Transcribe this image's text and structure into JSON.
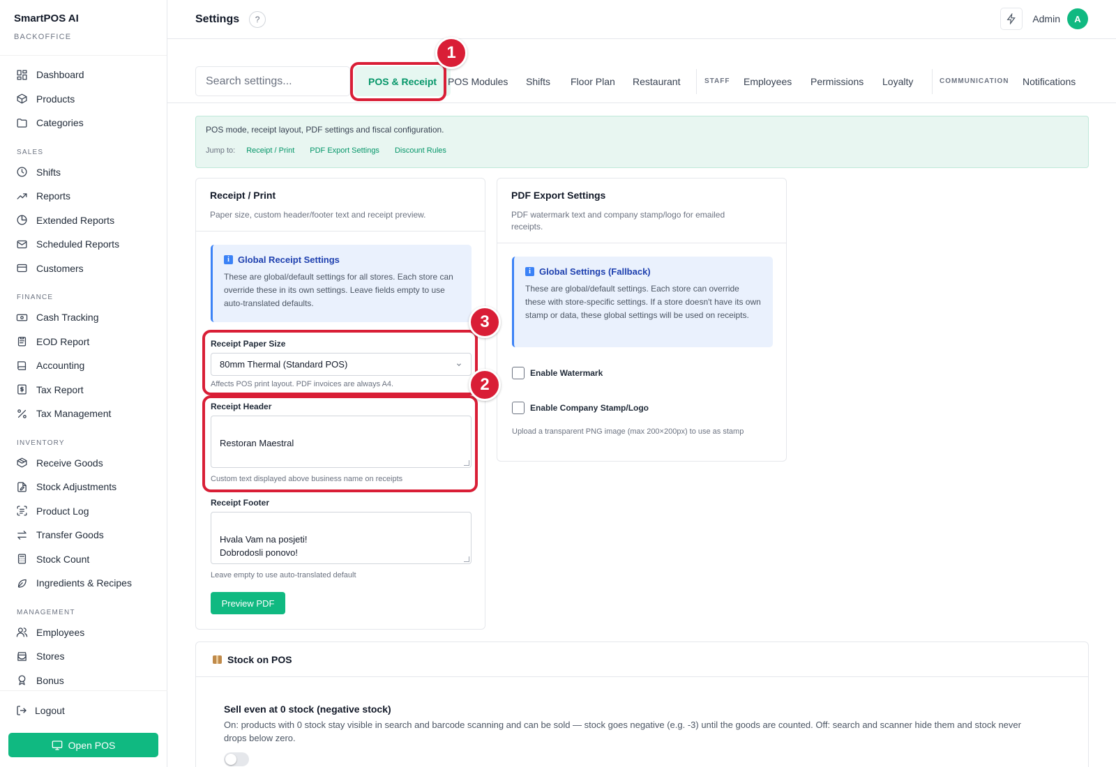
{
  "sidebar": {
    "brand_title": "SmartPOS AI",
    "brand_subtitle": "BACKOFFICE",
    "sections": [
      {
        "label": "",
        "items": [
          {
            "label": "Dashboard",
            "icon": "dashboard-icon"
          },
          {
            "label": "Products",
            "icon": "box-icon"
          },
          {
            "label": "Categories",
            "icon": "folder-icon"
          }
        ]
      },
      {
        "label": "SALES",
        "items": [
          {
            "label": "Shifts",
            "icon": "clock-icon"
          },
          {
            "label": "Reports",
            "icon": "trending-icon"
          },
          {
            "label": "Extended Reports",
            "icon": "pie-icon"
          },
          {
            "label": "Scheduled Reports",
            "icon": "mail-icon"
          },
          {
            "label": "Customers",
            "icon": "card-icon"
          }
        ]
      },
      {
        "label": "FINANCE",
        "items": [
          {
            "label": "Cash Tracking",
            "icon": "cash-icon"
          },
          {
            "label": "EOD Report",
            "icon": "clipboard-icon"
          },
          {
            "label": "Accounting",
            "icon": "book-icon"
          },
          {
            "label": "Tax Report",
            "icon": "dollar-icon"
          },
          {
            "label": "Tax Management",
            "icon": "percent-icon"
          }
        ]
      },
      {
        "label": "INVENTORY",
        "items": [
          {
            "label": "Receive Goods",
            "icon": "package-icon"
          },
          {
            "label": "Stock Adjustments",
            "icon": "file-edit-icon"
          },
          {
            "label": "Product Log",
            "icon": "scan-icon"
          },
          {
            "label": "Transfer Goods",
            "icon": "transfer-icon"
          },
          {
            "label": "Stock Count",
            "icon": "calculator-icon"
          },
          {
            "label": "Ingredients & Recipes",
            "icon": "leaf-icon"
          }
        ]
      },
      {
        "label": "MANAGEMENT",
        "items": [
          {
            "label": "Employees",
            "icon": "users-icon"
          },
          {
            "label": "Stores",
            "icon": "store-icon"
          },
          {
            "label": "Bonus",
            "icon": "award-icon"
          }
        ]
      }
    ],
    "logout_label": "Logout",
    "open_pos_label": "Open POS"
  },
  "header": {
    "title": "Settings",
    "help_glyph": "?",
    "user_name": "Admin",
    "avatar_initial": "A"
  },
  "tabs": {
    "search_placeholder": "Search settings...",
    "items": [
      "POS & Receipt",
      "POS Modules",
      "Shifts",
      "Floor Plan",
      "Restaurant",
      "Employees",
      "Permissions",
      "Loyalty",
      "Notifications"
    ],
    "group_staff": "STAFF",
    "group_communication": "COMMUNICATION"
  },
  "banner": {
    "text": "POS mode, receipt layout, PDF settings and fiscal configuration.",
    "jump_label": "Jump to:",
    "links": [
      "Receipt / Print",
      "PDF Export Settings",
      "Discount Rules"
    ]
  },
  "receipt_card": {
    "title": "Receipt / Print",
    "subtitle": "Paper size, custom header/footer text and receipt preview.",
    "info_title": "Global Receipt Settings",
    "info_text": "These are global/default settings for all stores. Each store can override these in its own settings. Leave fields empty to use auto-translated defaults.",
    "paper_size_label": "Receipt Paper Size",
    "paper_size_value": "80mm Thermal (Standard POS)",
    "paper_size_hint": "Affects POS print layout. PDF invoices are always A4.",
    "header_label": "Receipt Header",
    "header_value": "Restoran Maestral",
    "header_hint": "Custom text displayed above business name on receipts",
    "footer_label": "Receipt Footer",
    "footer_value": "Hvala Vam na posjeti!\nDobrodosli ponovo!",
    "footer_hint": "Leave empty to use auto-translated default",
    "preview_button": "Preview PDF"
  },
  "pdf_card": {
    "title": "PDF Export Settings",
    "subtitle": "PDF watermark text and company stamp/logo for emailed receipts.",
    "info_title": "Global Settings (Fallback)",
    "info_text": "These are global/default settings. Each store can override these with store-specific settings. If a store doesn't have its own stamp or data, these global settings will be used on receipts.",
    "watermark_label": "Enable Watermark",
    "stamp_label": "Enable Company Stamp/Logo",
    "stamp_hint": "Upload a transparent PNG image (max 200×200px) to use as stamp"
  },
  "stock_card": {
    "title": "Stock on POS",
    "option_title": "Sell even at 0 stock (negative stock)",
    "option_desc": "On: products with 0 stock stay visible in search and barcode scanning and can be sold — stock goes negative (e.g. -3) until the goods are counted. Off: search and scanner hide them and stock never drops below zero.",
    "negative_stock_enabled": false
  },
  "annotations": {
    "badge_1": "1",
    "badge_2": "2",
    "badge_3": "3",
    "color": "#d91e36"
  },
  "colors": {
    "accent": "#10b981",
    "accent_dark": "#059669",
    "info_blue": "#3b82f6"
  }
}
